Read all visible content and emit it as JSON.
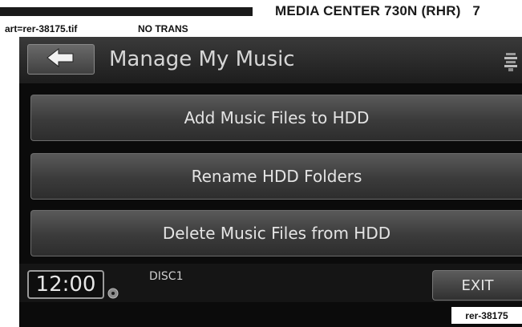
{
  "page_header": {
    "section_title": "MEDIA CENTER 730N (RHR)",
    "page_number": "7",
    "art_file": "art=rer-38175.tif",
    "trans_note": "NO TRANS"
  },
  "screen": {
    "title": "Manage My Music",
    "back_icon": "back-arrow-icon",
    "settings_icon": "settings-icon",
    "menu_items": [
      {
        "label": "Add Music Files to HDD"
      },
      {
        "label": "Rename HDD Folders"
      },
      {
        "label": "Delete Music Files from HDD"
      }
    ],
    "status_bar": {
      "clock": "12:00",
      "source": "DISC1",
      "exit_label": "EXIT"
    }
  },
  "art_tag": "rer-38175",
  "colors": {
    "screen_bg": "#0b0b0b",
    "button_text": "#e4e4e4",
    "page_bg": "#ffffff"
  }
}
